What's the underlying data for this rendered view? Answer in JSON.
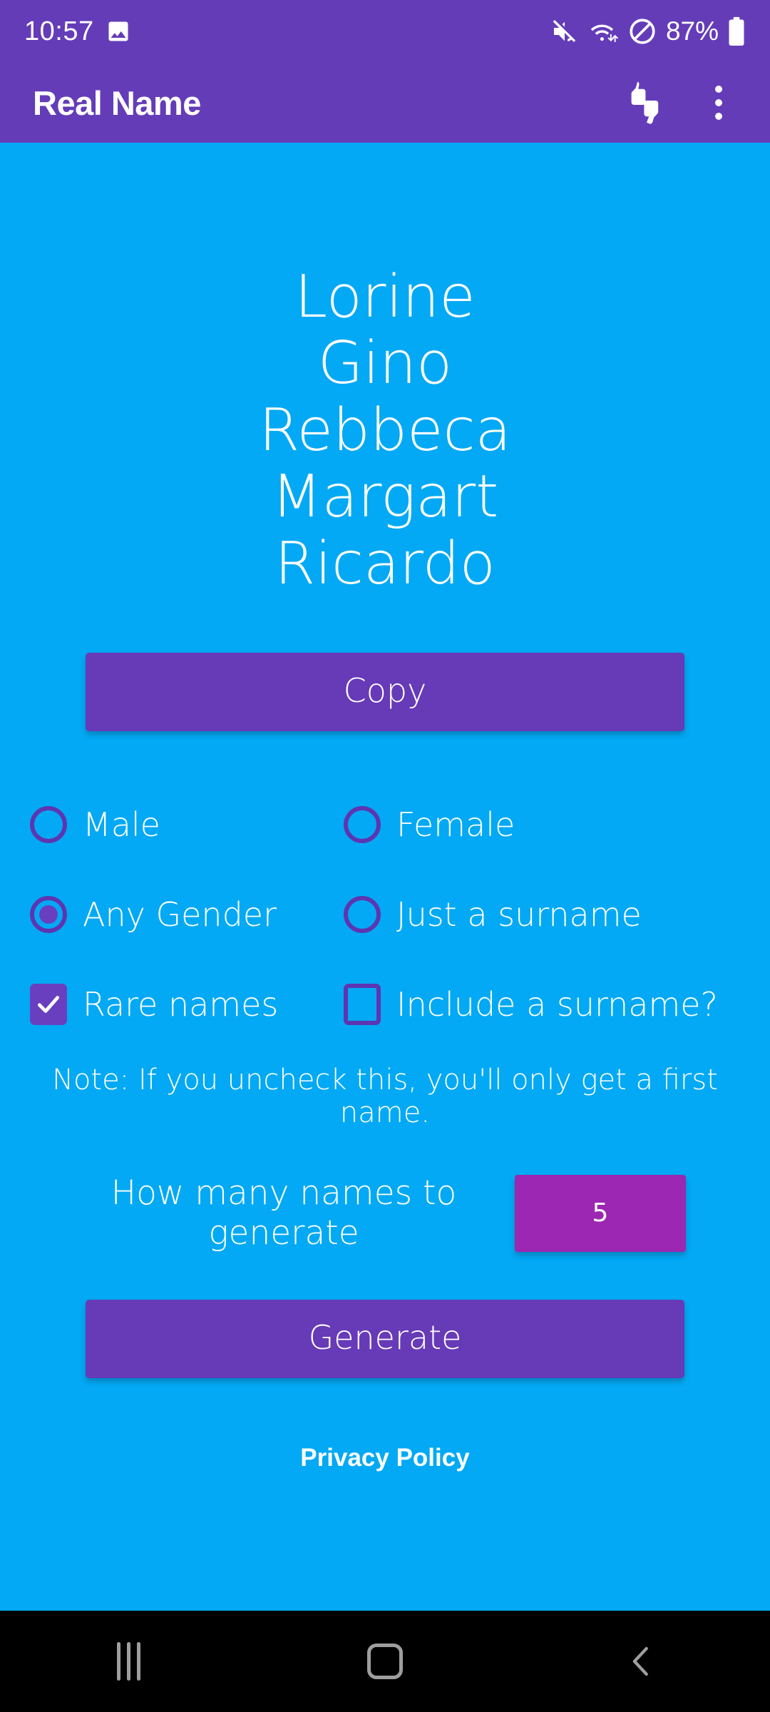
{
  "statusbar": {
    "time": "10:57",
    "battery_percent": "87%",
    "icons": [
      "image-icon",
      "mute-icon",
      "wifi-icon",
      "do-not-disturb-icon",
      "battery-icon"
    ]
  },
  "appbar": {
    "title": "Real Name",
    "feedback_icon": "thumbs-up-down-icon",
    "overflow_icon": "more-vert-icon",
    "background_color": "#643CB8"
  },
  "main": {
    "names": [
      "Lorine",
      "Gino",
      "Rebbeca",
      "Margart",
      "Ricardo"
    ],
    "copy_label": "Copy",
    "gender_options": [
      {
        "label": "Male",
        "checked": false
      },
      {
        "label": "Female",
        "checked": false
      },
      {
        "label": "Any Gender",
        "checked": true
      },
      {
        "label": "Just a surname",
        "checked": false
      }
    ],
    "checkboxes": [
      {
        "label": "Rare names",
        "checked": true
      },
      {
        "label": "Include a surname?",
        "checked": false
      }
    ],
    "note": "Note: If you uncheck this, you'll only get a first name.",
    "count_label": "How many names to generate",
    "count_value": "5",
    "generate_label": "Generate",
    "privacy_label": "Privacy Policy",
    "background_color": "#03A9F4",
    "accent_color": "#673AB7",
    "input_color": "#9C27B2"
  },
  "navbar": {
    "recents_icon": "recents-icon",
    "home_icon": "home-icon",
    "back_icon": "back-icon"
  }
}
